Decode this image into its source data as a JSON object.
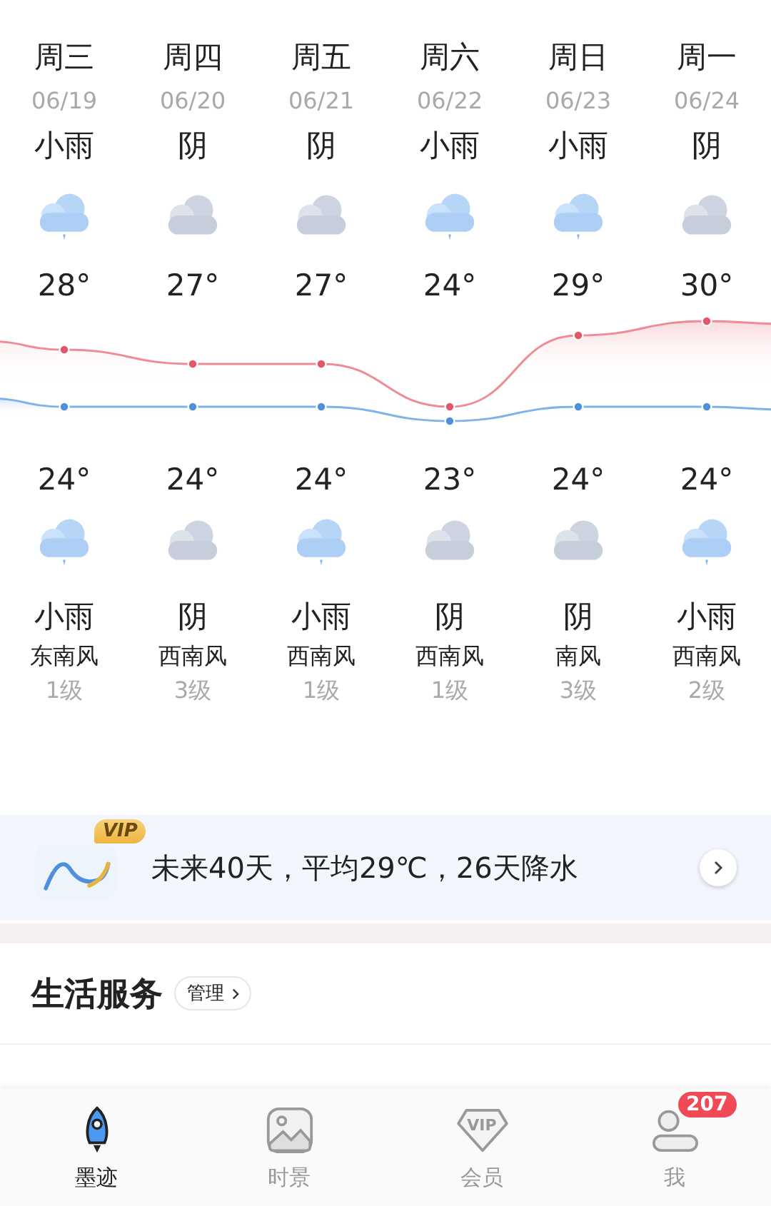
{
  "days": [
    {
      "weekday": "周三",
      "date": "06/19",
      "day": {
        "condition": "小雨",
        "kind": "rain"
      },
      "high": "28°",
      "low": "24°",
      "night": {
        "kind": "rain",
        "condition": "小雨"
      },
      "wind": "东南风",
      "wind_level": "1级"
    },
    {
      "weekday": "周四",
      "date": "06/20",
      "day": {
        "condition": "阴",
        "kind": "cloudy"
      },
      "high": "27°",
      "low": "24°",
      "night": {
        "kind": "cloudy",
        "condition": "阴"
      },
      "wind": "西南风",
      "wind_level": "3级"
    },
    {
      "weekday": "周五",
      "date": "06/21",
      "day": {
        "condition": "阴",
        "kind": "cloudy"
      },
      "high": "27°",
      "low": "24°",
      "night": {
        "kind": "rain",
        "condition": "小雨"
      },
      "wind": "西南风",
      "wind_level": "1级"
    },
    {
      "weekday": "周六",
      "date": "06/22",
      "day": {
        "condition": "小雨",
        "kind": "rain"
      },
      "high": "24°",
      "low": "23°",
      "night": {
        "kind": "cloudy",
        "condition": "阴"
      },
      "wind": "西南风",
      "wind_level": "1级"
    },
    {
      "weekday": "周日",
      "date": "06/23",
      "day": {
        "condition": "小雨",
        "kind": "rain"
      },
      "high": "29°",
      "low": "24°",
      "night": {
        "kind": "cloudy",
        "condition": "阴"
      },
      "wind": "南风",
      "wind_level": "3级"
    },
    {
      "weekday": "周一",
      "date": "06/24",
      "day": {
        "condition": "阴",
        "kind": "cloudy"
      },
      "high": "30°",
      "low": "24°",
      "night": {
        "kind": "rain",
        "condition": "小雨"
      },
      "wind": "西南风",
      "wind_level": "2级"
    }
  ],
  "forecast_banner": {
    "badge": "VIP",
    "text": "未来40天，平均29℃，26天降水"
  },
  "life_services": {
    "title": "生活服务",
    "manage": "管理"
  },
  "tab_bar": [
    {
      "label": "墨迹",
      "kind": "rocket",
      "selected": true
    },
    {
      "label": "时景",
      "kind": "photo",
      "selected": false
    },
    {
      "label": "会员",
      "kind": "vip",
      "selected": false,
      "icon_text": "VIP"
    },
    {
      "label": "我",
      "kind": "person",
      "selected": false,
      "badge": "207"
    }
  ]
}
